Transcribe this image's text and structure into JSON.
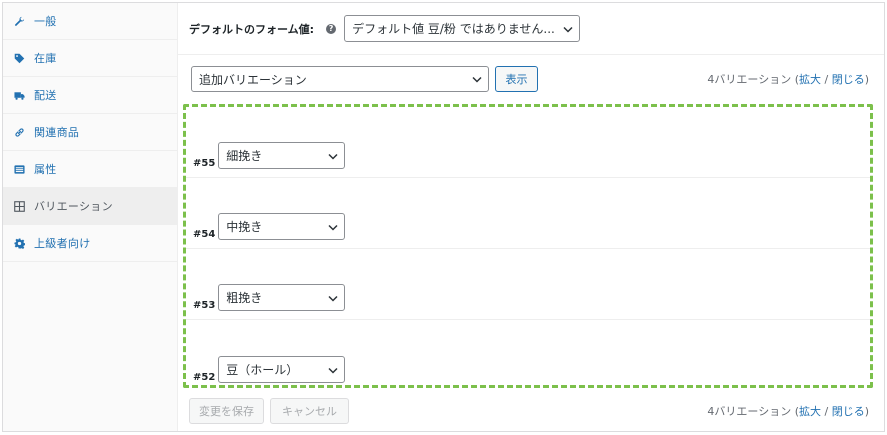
{
  "sidebar": {
    "items": [
      {
        "label": "一般",
        "icon": "wrench-icon"
      },
      {
        "label": "在庫",
        "icon": "tag-icon"
      },
      {
        "label": "配送",
        "icon": "truck-icon"
      },
      {
        "label": "関連商品",
        "icon": "link-icon"
      },
      {
        "label": "属性",
        "icon": "list-icon"
      },
      {
        "label": "バリエーション",
        "icon": "grid-icon",
        "active": true
      },
      {
        "label": "上級者向け",
        "icon": "gear-icon"
      }
    ]
  },
  "defaults": {
    "label": "デフォルトのフォーム値:",
    "help": "?",
    "value": "デフォルト値 豆/粉 ではありません..."
  },
  "add_variation": {
    "select_value": "追加バリエーション",
    "show_button": "表示"
  },
  "count": {
    "text": "4バリエーション",
    "open": "(",
    "expand": "拡大",
    "sep": " / ",
    "collapse": "閉じる",
    "close": ")"
  },
  "variations": [
    {
      "number": "#55",
      "value": "細挽き"
    },
    {
      "number": "#54",
      "value": "中挽き"
    },
    {
      "number": "#53",
      "value": "粗挽き"
    },
    {
      "number": "#52",
      "value": "豆（ホール）"
    }
  ],
  "footer": {
    "save_button": "変更を保存",
    "cancel_button": "キャンセル"
  },
  "colors": {
    "accent": "#2271b1",
    "highlight_border": "#7cc04b"
  }
}
